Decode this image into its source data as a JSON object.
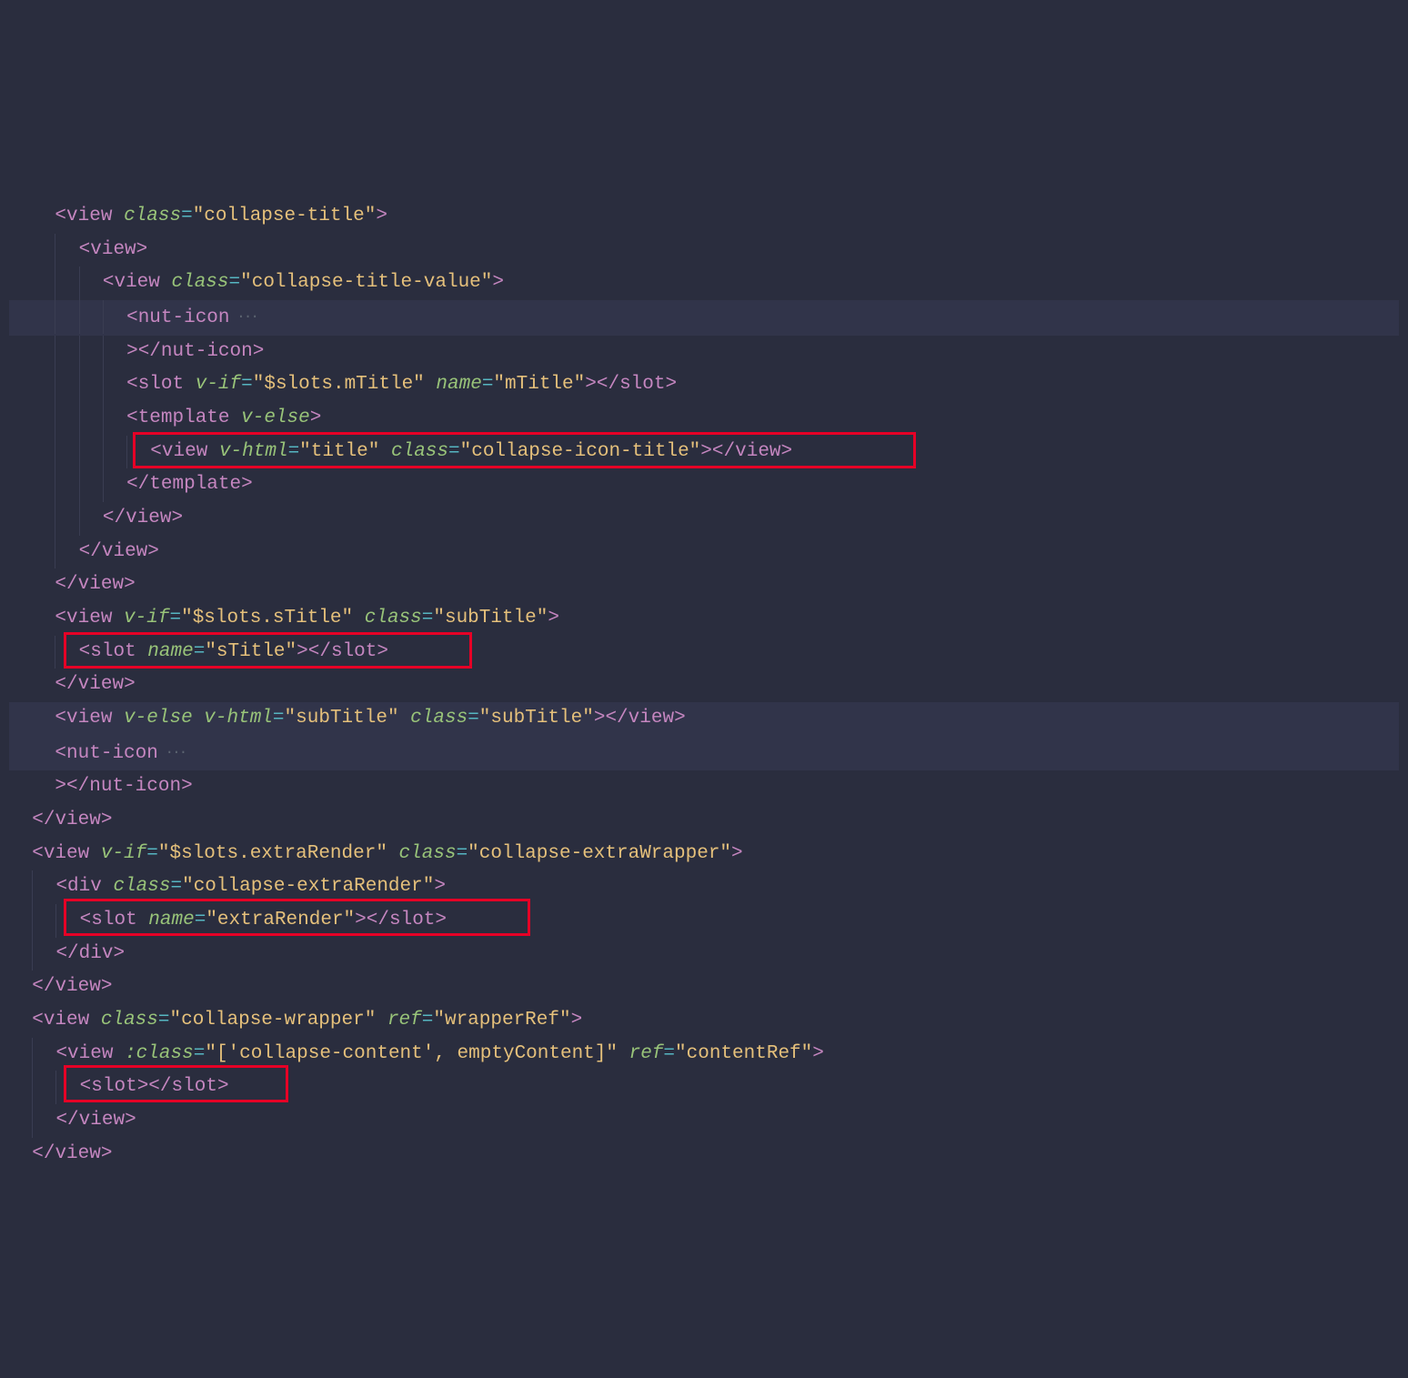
{
  "lines": [
    {
      "indent": 2,
      "hl": false,
      "tokens": [
        {
          "t": "bracket",
          "v": "<"
        },
        {
          "t": "tag",
          "v": "view"
        },
        {
          "t": "plain",
          "v": " "
        },
        {
          "t": "attr",
          "v": "class"
        },
        {
          "t": "eq",
          "v": "="
        },
        {
          "t": "str",
          "v": "\"collapse-title\""
        },
        {
          "t": "bracket",
          "v": ">"
        }
      ]
    },
    {
      "indent": 3,
      "hl": false,
      "guides": [
        2
      ],
      "tokens": [
        {
          "t": "bracket",
          "v": "<"
        },
        {
          "t": "tag",
          "v": "view"
        },
        {
          "t": "bracket",
          "v": ">"
        }
      ]
    },
    {
      "indent": 4,
      "hl": false,
      "guides": [
        2,
        3
      ],
      "tokens": [
        {
          "t": "bracket",
          "v": "<"
        },
        {
          "t": "tag",
          "v": "view"
        },
        {
          "t": "plain",
          "v": " "
        },
        {
          "t": "attr",
          "v": "class"
        },
        {
          "t": "eq",
          "v": "="
        },
        {
          "t": "str",
          "v": "\"collapse-title-value\""
        },
        {
          "t": "bracket",
          "v": ">"
        }
      ]
    },
    {
      "indent": 5,
      "hl": true,
      "guides": [
        2,
        3,
        4
      ],
      "tokens": [
        {
          "t": "bracket",
          "v": "<"
        },
        {
          "t": "tag",
          "v": "nut-icon"
        },
        {
          "t": "fold",
          "v": " ···"
        }
      ]
    },
    {
      "indent": 5,
      "hl": false,
      "guides": [
        2,
        3,
        4
      ],
      "tokens": [
        {
          "t": "bracket",
          "v": ">"
        },
        {
          "t": "bracket",
          "v": "</"
        },
        {
          "t": "tag",
          "v": "nut-icon"
        },
        {
          "t": "bracket",
          "v": ">"
        }
      ]
    },
    {
      "indent": 5,
      "hl": false,
      "guides": [
        2,
        3,
        4
      ],
      "tokens": [
        {
          "t": "bracket",
          "v": "<"
        },
        {
          "t": "tag",
          "v": "slot"
        },
        {
          "t": "plain",
          "v": " "
        },
        {
          "t": "attr",
          "v": "v-if"
        },
        {
          "t": "eq",
          "v": "="
        },
        {
          "t": "str",
          "v": "\"$slots.mTitle\""
        },
        {
          "t": "plain",
          "v": " "
        },
        {
          "t": "attr",
          "v": "name"
        },
        {
          "t": "eq",
          "v": "="
        },
        {
          "t": "str",
          "v": "\"mTitle\""
        },
        {
          "t": "bracket",
          "v": ">"
        },
        {
          "t": "bracket",
          "v": "</"
        },
        {
          "t": "tag",
          "v": "slot"
        },
        {
          "t": "bracket",
          "v": ">"
        }
      ]
    },
    {
      "indent": 5,
      "hl": false,
      "guides": [
        2,
        3,
        4
      ],
      "tokens": [
        {
          "t": "bracket",
          "v": "<"
        },
        {
          "t": "tag",
          "v": "template"
        },
        {
          "t": "plain",
          "v": " "
        },
        {
          "t": "attr",
          "v": "v-else"
        },
        {
          "t": "bracket",
          "v": ">"
        }
      ]
    },
    {
      "indent": 6,
      "hl": false,
      "guides": [
        2,
        3,
        4,
        5
      ],
      "tokens": [
        {
          "t": "bracket",
          "v": "<"
        },
        {
          "t": "tag",
          "v": "view"
        },
        {
          "t": "plain",
          "v": " "
        },
        {
          "t": "attr",
          "v": "v-html"
        },
        {
          "t": "eq",
          "v": "="
        },
        {
          "t": "str",
          "v": "\"title\""
        },
        {
          "t": "plain",
          "v": " "
        },
        {
          "t": "attr",
          "v": "class"
        },
        {
          "t": "eq",
          "v": "="
        },
        {
          "t": "str",
          "v": "\"collapse-icon-title\""
        },
        {
          "t": "bracket",
          "v": ">"
        },
        {
          "t": "bracket",
          "v": "</"
        },
        {
          "t": "tag",
          "v": "view"
        },
        {
          "t": "bracket",
          "v": ">"
        }
      ]
    },
    {
      "indent": 5,
      "hl": false,
      "guides": [
        2,
        3,
        4
      ],
      "tokens": [
        {
          "t": "bracket",
          "v": "</"
        },
        {
          "t": "tag",
          "v": "template"
        },
        {
          "t": "bracket",
          "v": ">"
        }
      ]
    },
    {
      "indent": 4,
      "hl": false,
      "guides": [
        2,
        3
      ],
      "tokens": [
        {
          "t": "bracket",
          "v": "</"
        },
        {
          "t": "tag",
          "v": "view"
        },
        {
          "t": "bracket",
          "v": ">"
        }
      ]
    },
    {
      "indent": 3,
      "hl": false,
      "guides": [
        2
      ],
      "tokens": [
        {
          "t": "bracket",
          "v": "</"
        },
        {
          "t": "tag",
          "v": "view"
        },
        {
          "t": "bracket",
          "v": ">"
        }
      ]
    },
    {
      "indent": 2,
      "hl": false,
      "tokens": [
        {
          "t": "bracket",
          "v": "</"
        },
        {
          "t": "tag",
          "v": "view"
        },
        {
          "t": "bracket",
          "v": ">"
        }
      ]
    },
    {
      "indent": 2,
      "hl": false,
      "tokens": [
        {
          "t": "bracket",
          "v": "<"
        },
        {
          "t": "tag",
          "v": "view"
        },
        {
          "t": "plain",
          "v": " "
        },
        {
          "t": "attr",
          "v": "v-if"
        },
        {
          "t": "eq",
          "v": "="
        },
        {
          "t": "str",
          "v": "\"$slots.sTitle\""
        },
        {
          "t": "plain",
          "v": " "
        },
        {
          "t": "attr",
          "v": "class"
        },
        {
          "t": "eq",
          "v": "="
        },
        {
          "t": "str",
          "v": "\"subTitle\""
        },
        {
          "t": "bracket",
          "v": ">"
        }
      ]
    },
    {
      "indent": 3,
      "hl": false,
      "guides": [
        2
      ],
      "tokens": [
        {
          "t": "bracket",
          "v": "<"
        },
        {
          "t": "tag",
          "v": "slot"
        },
        {
          "t": "plain",
          "v": " "
        },
        {
          "t": "attr",
          "v": "name"
        },
        {
          "t": "eq",
          "v": "="
        },
        {
          "t": "str",
          "v": "\"sTitle\""
        },
        {
          "t": "bracket",
          "v": ">"
        },
        {
          "t": "bracket",
          "v": "</"
        },
        {
          "t": "tag",
          "v": "slot"
        },
        {
          "t": "bracket",
          "v": ">"
        }
      ]
    },
    {
      "indent": 2,
      "hl": false,
      "tokens": [
        {
          "t": "bracket",
          "v": "</"
        },
        {
          "t": "tag",
          "v": "view"
        },
        {
          "t": "bracket",
          "v": ">"
        }
      ]
    },
    {
      "indent": 2,
      "hl": true,
      "tokens": [
        {
          "t": "bracket",
          "v": "<"
        },
        {
          "t": "tag",
          "v": "view"
        },
        {
          "t": "plain",
          "v": " "
        },
        {
          "t": "attr",
          "v": "v-else"
        },
        {
          "t": "plain",
          "v": " "
        },
        {
          "t": "attr",
          "v": "v-html"
        },
        {
          "t": "eq",
          "v": "="
        },
        {
          "t": "str",
          "v": "\"subTitle\""
        },
        {
          "t": "plain",
          "v": " "
        },
        {
          "t": "attr",
          "v": "class"
        },
        {
          "t": "eq",
          "v": "="
        },
        {
          "t": "str",
          "v": "\"subTitle\""
        },
        {
          "t": "bracket",
          "v": ">"
        },
        {
          "t": "bracket",
          "v": "</"
        },
        {
          "t": "tag",
          "v": "view"
        },
        {
          "t": "bracket",
          "v": ">"
        }
      ]
    },
    {
      "indent": 2,
      "hl": true,
      "tokens": [
        {
          "t": "bracket",
          "v": "<"
        },
        {
          "t": "tag",
          "v": "nut-icon"
        },
        {
          "t": "fold",
          "v": " ···"
        }
      ]
    },
    {
      "indent": 2,
      "hl": false,
      "tokens": [
        {
          "t": "bracket",
          "v": ">"
        },
        {
          "t": "bracket",
          "v": "</"
        },
        {
          "t": "tag",
          "v": "nut-icon"
        },
        {
          "t": "bracket",
          "v": ">"
        }
      ]
    },
    {
      "indent": 1,
      "hl": false,
      "tokens": [
        {
          "t": "bracket",
          "v": "</"
        },
        {
          "t": "tag",
          "v": "view"
        },
        {
          "t": "bracket",
          "v": ">"
        }
      ]
    },
    {
      "indent": 1,
      "hl": false,
      "tokens": [
        {
          "t": "bracket",
          "v": "<"
        },
        {
          "t": "tag",
          "v": "view"
        },
        {
          "t": "plain",
          "v": " "
        },
        {
          "t": "attr",
          "v": "v-if"
        },
        {
          "t": "eq",
          "v": "="
        },
        {
          "t": "str",
          "v": "\"$slots.extraRender\""
        },
        {
          "t": "plain",
          "v": " "
        },
        {
          "t": "attr",
          "v": "class"
        },
        {
          "t": "eq",
          "v": "="
        },
        {
          "t": "str",
          "v": "\"collapse-extraWrapper\""
        },
        {
          "t": "bracket",
          "v": ">"
        }
      ]
    },
    {
      "indent": 2,
      "hl": false,
      "guides": [
        1
      ],
      "tokens": [
        {
          "t": "bracket",
          "v": "<"
        },
        {
          "t": "tag",
          "v": "div"
        },
        {
          "t": "plain",
          "v": " "
        },
        {
          "t": "attr",
          "v": "class"
        },
        {
          "t": "eq",
          "v": "="
        },
        {
          "t": "str",
          "v": "\"collapse-extraRender\""
        },
        {
          "t": "bracket",
          "v": ">"
        }
      ]
    },
    {
      "indent": 3,
      "hl": false,
      "guides": [
        1,
        2
      ],
      "tokens": [
        {
          "t": "bracket",
          "v": "<"
        },
        {
          "t": "tag",
          "v": "slot"
        },
        {
          "t": "plain",
          "v": " "
        },
        {
          "t": "attr",
          "v": "name"
        },
        {
          "t": "eq",
          "v": "="
        },
        {
          "t": "str",
          "v": "\"extraRender\""
        },
        {
          "t": "bracket",
          "v": ">"
        },
        {
          "t": "bracket",
          "v": "</"
        },
        {
          "t": "tag",
          "v": "slot"
        },
        {
          "t": "bracket",
          "v": ">"
        }
      ]
    },
    {
      "indent": 2,
      "hl": false,
      "guides": [
        1
      ],
      "tokens": [
        {
          "t": "bracket",
          "v": "</"
        },
        {
          "t": "tag",
          "v": "div"
        },
        {
          "t": "bracket",
          "v": ">"
        }
      ]
    },
    {
      "indent": 1,
      "hl": false,
      "tokens": [
        {
          "t": "bracket",
          "v": "</"
        },
        {
          "t": "tag",
          "v": "view"
        },
        {
          "t": "bracket",
          "v": ">"
        }
      ]
    },
    {
      "indent": 1,
      "hl": false,
      "tokens": [
        {
          "t": "bracket",
          "v": "<"
        },
        {
          "t": "tag",
          "v": "view"
        },
        {
          "t": "plain",
          "v": " "
        },
        {
          "t": "attr",
          "v": "class"
        },
        {
          "t": "eq",
          "v": "="
        },
        {
          "t": "str",
          "v": "\"collapse-wrapper\""
        },
        {
          "t": "plain",
          "v": " "
        },
        {
          "t": "attr",
          "v": "ref"
        },
        {
          "t": "eq",
          "v": "="
        },
        {
          "t": "str",
          "v": "\"wrapperRef\""
        },
        {
          "t": "bracket",
          "v": ">"
        }
      ]
    },
    {
      "indent": 2,
      "hl": false,
      "guides": [
        1
      ],
      "tokens": [
        {
          "t": "bracket",
          "v": "<"
        },
        {
          "t": "tag",
          "v": "view"
        },
        {
          "t": "plain",
          "v": " "
        },
        {
          "t": "attr",
          "v": ":class"
        },
        {
          "t": "eq",
          "v": "="
        },
        {
          "t": "str",
          "v": "\"['collapse-content', emptyContent]\""
        },
        {
          "t": "plain",
          "v": " "
        },
        {
          "t": "attr",
          "v": "ref"
        },
        {
          "t": "eq",
          "v": "="
        },
        {
          "t": "str",
          "v": "\"contentRef\""
        },
        {
          "t": "bracket",
          "v": ">"
        }
      ]
    },
    {
      "indent": 3,
      "hl": false,
      "guides": [
        1,
        2
      ],
      "tokens": [
        {
          "t": "bracket",
          "v": "<"
        },
        {
          "t": "tag",
          "v": "slot"
        },
        {
          "t": "bracket",
          "v": ">"
        },
        {
          "t": "bracket",
          "v": "</"
        },
        {
          "t": "tag",
          "v": "slot"
        },
        {
          "t": "bracket",
          "v": ">"
        }
      ]
    },
    {
      "indent": 2,
      "hl": false,
      "guides": [
        1
      ],
      "tokens": [
        {
          "t": "bracket",
          "v": "</"
        },
        {
          "t": "tag",
          "v": "view"
        },
        {
          "t": "bracket",
          "v": ">"
        }
      ]
    },
    {
      "indent": 1,
      "hl": false,
      "tokens": [
        {
          "t": "bracket",
          "v": "</"
        },
        {
          "t": "tag",
          "v": "view"
        },
        {
          "t": "bracket",
          "v": ">"
        }
      ]
    }
  ],
  "redboxes": [
    {
      "lineIndex": 7,
      "leftCh": 5.7,
      "widthCh": 66.5
    },
    {
      "lineIndex": 13,
      "leftCh": 2.6,
      "widthCh": 33.5
    },
    {
      "lineIndex": 21,
      "leftCh": 2.6,
      "widthCh": 39
    },
    {
      "lineIndex": 26,
      "leftCh": 2.6,
      "widthCh": 18
    }
  ],
  "indentUnitCh": 2,
  "baseIndentPx": 10
}
